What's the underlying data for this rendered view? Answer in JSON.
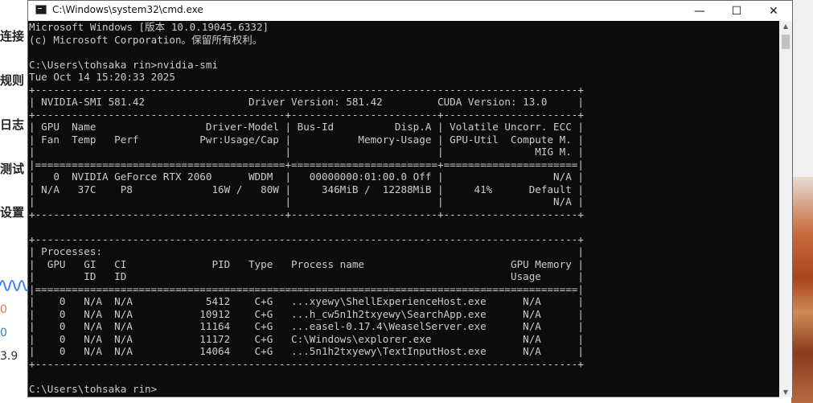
{
  "window": {
    "title": "C:\\Windows\\system32\\cmd.exe",
    "buttons": {
      "minimize": "—",
      "maximize": "☐",
      "close": "✕"
    }
  },
  "console_lines": [
    "Microsoft Windows [版本 10.0.19045.6332]",
    "(c) Microsoft Corporation。保留所有权利。",
    "",
    "C:\\Users\\tohsaka rin>nvidia-smi",
    "Tue Oct 14 15:20:33 2025",
    "+-----------------------------------------------------------------------------------------+",
    "| NVIDIA-SMI 581.42                 Driver Version: 581.42         CUDA Version: 13.0     |",
    "+-----------------------------------------+------------------------+----------------------+",
    "| GPU  Name                  Driver-Model | Bus-Id          Disp.A | Volatile Uncorr. ECC |",
    "| Fan  Temp   Perf          Pwr:Usage/Cap |           Memory-Usage | GPU-Util  Compute M. |",
    "|                                         |                        |               MIG M. |",
    "|=========================================+========================+======================|",
    "|   0  NVIDIA GeForce RTX 2060      WDDM  |   00000000:01:00.0 Off |                  N/A |",
    "| N/A   37C    P8             16W /   80W |     346MiB /  12288MiB |     41%      Default |",
    "|                                         |                        |                  N/A |",
    "+-----------------------------------------+------------------------+----------------------+",
    "",
    "+-----------------------------------------------------------------------------------------+",
    "| Processes:                                                                              |",
    "|  GPU   GI   CI              PID   Type   Process name                        GPU Memory |",
    "|        ID   ID                                                               Usage      |",
    "|=========================================================================================|",
    "|    0   N/A  N/A            5412    C+G   ...xyewy\\ShellExperienceHost.exe      N/A      |",
    "|    0   N/A  N/A           10912    C+G   ...h_cw5n1h2txyewy\\SearchApp.exe      N/A      |",
    "|    0   N/A  N/A           11164    C+G   ...easel-0.17.4\\WeaselServer.exe      N/A      |",
    "|    0   N/A  N/A           11172    C+G   C:\\Windows\\explorer.exe               N/A      |",
    "|    0   N/A  N/A           14064    C+G   ...5n1h2txyewy\\TextInputHost.exe      N/A      |",
    "+-----------------------------------------------------------------------------------------+",
    "",
    "C:\\Users\\tohsaka rin>"
  ],
  "background_app": {
    "menu_items": [
      "连接",
      "规则",
      "日志",
      "测试",
      "设置"
    ],
    "stats": [
      {
        "text": "0",
        "color": "#e8734a"
      },
      {
        "text": "0",
        "color": "#2f7de1"
      },
      {
        "text": "3.9",
        "color": "#333333"
      }
    ],
    "wave_color": "#3b82f6"
  }
}
